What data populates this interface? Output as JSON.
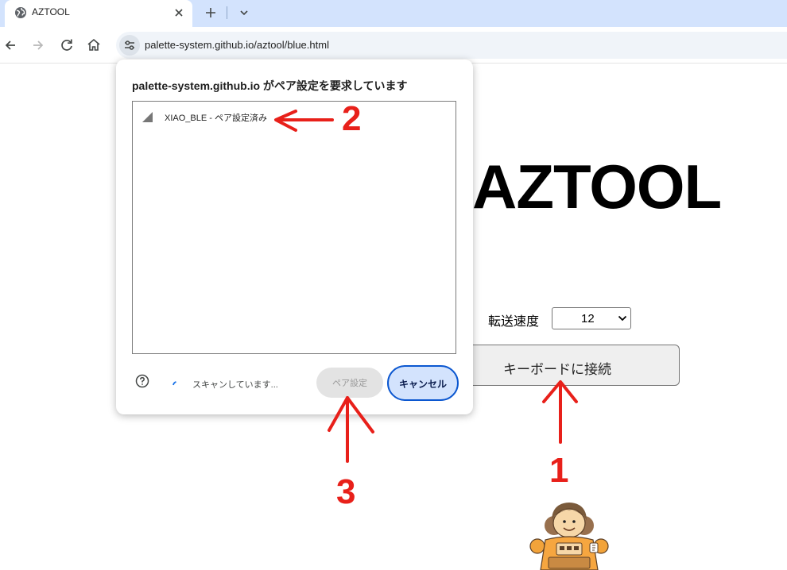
{
  "browser": {
    "tab": {
      "title": "AZTOOL"
    },
    "address_bar": {
      "url": "palette-system.github.io/aztool/blue.html"
    }
  },
  "page": {
    "title": "AZTOOL",
    "speed": {
      "label": "転送速度",
      "selected": "12"
    },
    "connect_button": "キーボードに接続"
  },
  "dialog": {
    "title": "palette-system.github.io がペア設定を要求しています",
    "devices": [
      {
        "label": "XIAO_BLE - ペア設定済み"
      }
    ],
    "status": "スキャンしています...",
    "pair_button": "ペア設定",
    "cancel_button": "キャンセル"
  },
  "annotations": [
    {
      "number": "1"
    },
    {
      "number": "2"
    },
    {
      "number": "3"
    }
  ],
  "colors": {
    "annotation": "#e8201a",
    "accent": "#0b57d0",
    "tabstrip": "#d3e3fd"
  }
}
